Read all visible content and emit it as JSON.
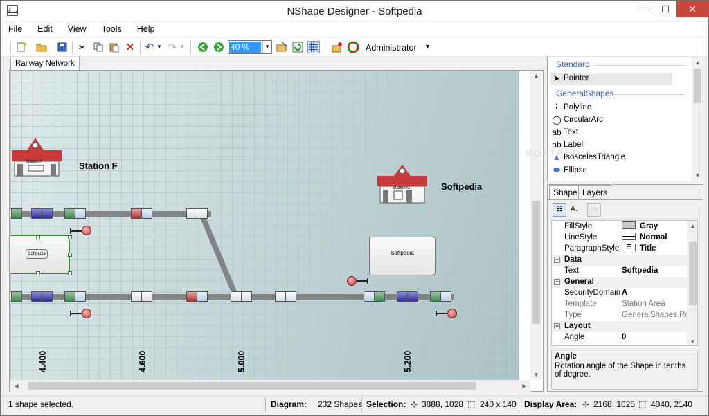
{
  "window": {
    "title": "NShape Designer - Softpedia",
    "minimize": "—",
    "maximize": "☐",
    "close": "✕"
  },
  "menu": [
    "File",
    "Edit",
    "View",
    "Tools",
    "Help"
  ],
  "toolbar": {
    "zoom": "40 %",
    "user": "Administrator"
  },
  "document_tab": "Railway Network",
  "canvas": {
    "stations": [
      {
        "label": "Station F",
        "sign": "Station F"
      },
      {
        "label": "Softpedia",
        "sign": "Station G"
      }
    ],
    "boxes": [
      "Softpedia",
      "Softpedia"
    ],
    "km_markers": [
      "4.400",
      "4.600",
      "5.000",
      "5.200"
    ]
  },
  "toolbox": {
    "categories": [
      "Standard",
      "GeneralShapes"
    ],
    "items": [
      {
        "label": "Pointer",
        "icon": "pointer-icon"
      },
      {
        "label": "Polyline",
        "icon": "polyline-icon"
      },
      {
        "label": "CircularArc",
        "icon": "arc-icon"
      },
      {
        "label": "Text",
        "icon": "text-icon"
      },
      {
        "label": "Label",
        "icon": "label-icon"
      },
      {
        "label": "IsoscelesTriangle",
        "icon": "triangle-icon"
      },
      {
        "label": "Ellipse",
        "icon": "ellipse-icon"
      }
    ]
  },
  "properties": {
    "tabs": [
      "Shape",
      "Layers"
    ],
    "rows": [
      {
        "name": "FillStyle",
        "value": "Gray"
      },
      {
        "name": "LineStyle",
        "value": "Normal"
      },
      {
        "name": "ParagraphStyle",
        "value": "Title"
      },
      {
        "category": "Data"
      },
      {
        "name": "Text",
        "value": "Softpedia"
      },
      {
        "category": "General"
      },
      {
        "name": "SecurityDomainN",
        "value": "A"
      },
      {
        "name": "Template",
        "value": "Station Area"
      },
      {
        "name": "Type",
        "value": "GeneralShapes.Rou"
      },
      {
        "category": "Layout"
      },
      {
        "name": "Angle",
        "value": "0"
      }
    ],
    "description_title": "Angle",
    "description_text": "Rotation angle of the Shape in tenths of degree."
  },
  "status": {
    "selected": "1 shape selected.",
    "diagram_label": "Diagram:",
    "diagram_value": "232 Shapes",
    "selection_label": "Selection:",
    "selection_pos": "3888, 1028",
    "selection_size": "240 x 140",
    "display_label": "Display Area:",
    "display_pos": "2168, 1025",
    "display_size": "4040, 2140"
  },
  "watermark": "SOFTPEDIA"
}
